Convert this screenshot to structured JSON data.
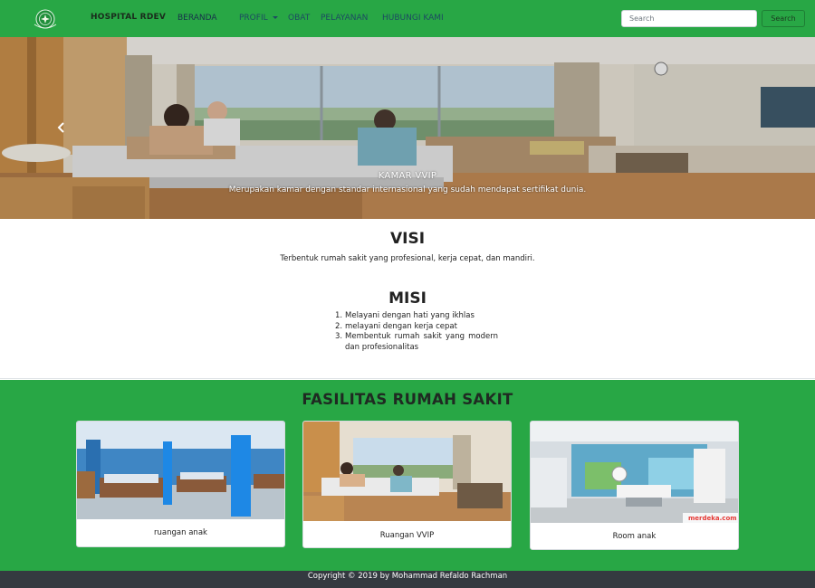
{
  "navbar": {
    "brand": "HOSPITAL RDEV",
    "logo_icon": "hospital-emblem-icon",
    "links": [
      "BERANDA",
      "PROFIL",
      "OBAT",
      "PELAYANAN",
      "HUBUNGI KAMI"
    ],
    "search_placeholder": "Search",
    "search_button": "Search"
  },
  "carousel": {
    "caption_title": "KAMAR VVIP",
    "caption_text": "Merupakan kamar dengan standar internasional yang sudah mendapat sertifikat dunia.",
    "prev_icon": "chevron-left-icon"
  },
  "visi": {
    "title": "VISI",
    "text": "Terbentuk rumah sakit yang profesional, kerja cepat, dan mandiri."
  },
  "misi": {
    "title": "MISI",
    "items": [
      "Melayani dengan hati yang ikhlas",
      "melayani dengan kerja cepat",
      "Membentuk rumah sakit yang modern dan profesionalitas"
    ]
  },
  "fasilitas": {
    "title": "FASILITAS RUMAH SAKIT",
    "cards": [
      {
        "label": "ruangan anak",
        "watermark": ""
      },
      {
        "label": "Ruangan VVIP",
        "watermark": ""
      },
      {
        "label": "Room anak",
        "watermark": "merdeka.com"
      }
    ]
  },
  "footer": {
    "text": "Copyright © 2019 by Mohammad Refaldo Rachman"
  },
  "colors": {
    "primary_green": "#28a745",
    "footer_dark": "#343a40"
  }
}
